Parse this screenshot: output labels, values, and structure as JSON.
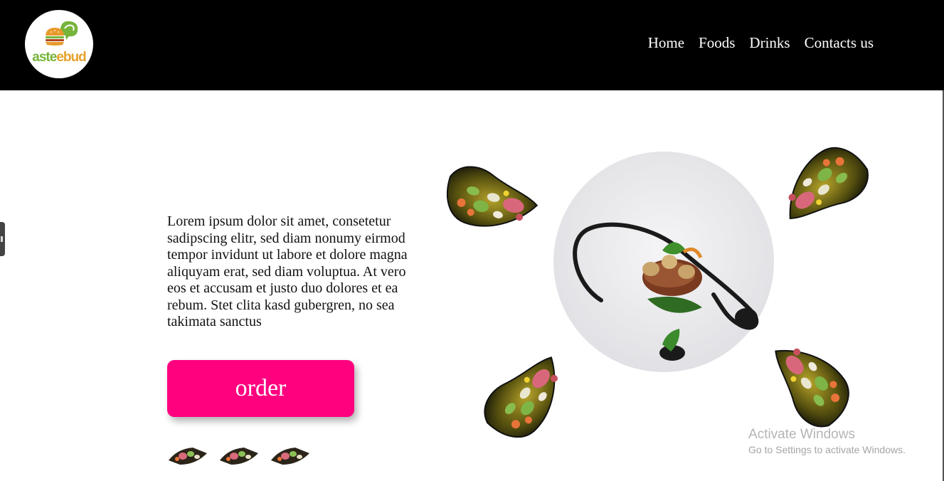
{
  "header": {
    "logo_text_a": "aste",
    "logo_text_b": "ebud",
    "nav": [
      "Home",
      "Foods",
      "Drinks",
      "Contacts us"
    ]
  },
  "hero": {
    "text": "Lorem ipsum dolor sit amet, consetetur sadipscing elitr, sed diam nonumy eirmod tempor invidunt ut labore et dolore magna aliquyam erat, sed diam voluptua. At vero eos et accusam et justo duo dolores et ea rebum. Stet clita kasd gubergren, no sea takimata sanctus",
    "order_label": "order",
    "thumbnail_count": 3
  },
  "watermark": {
    "title": "Activate Windows",
    "subtitle": "Go to Settings to activate Windows."
  },
  "colors": {
    "header_bg": "#000000",
    "accent": "#ff007f",
    "logo_orange": "#e6a12b",
    "logo_green": "#76b43a"
  },
  "icons": [
    "burger-logo-icon",
    "chat-bubble-icon"
  ]
}
